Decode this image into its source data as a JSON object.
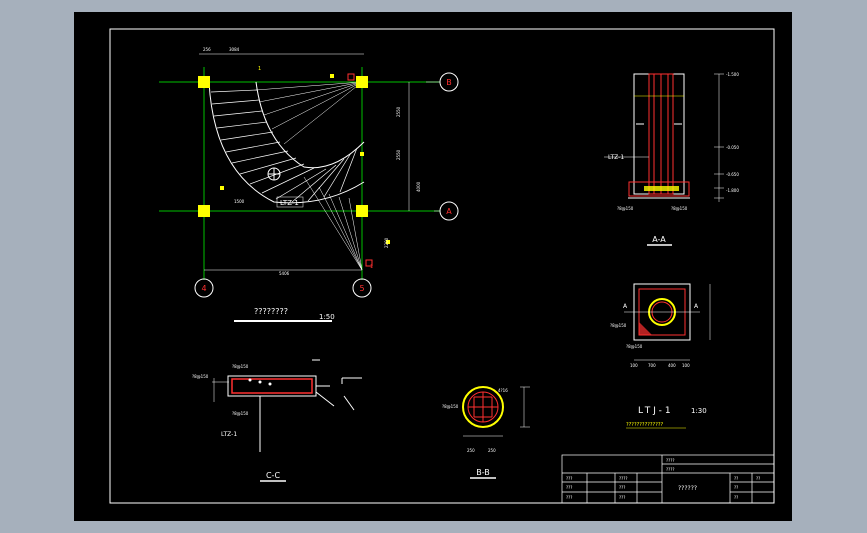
{
  "plan": {
    "axes": {
      "top_right": "B",
      "bottom_right": "A",
      "bottom_left": "4",
      "bottom_mid": "5"
    },
    "title": "????????",
    "scale": "1:50",
    "dims": [
      "256",
      "3084",
      "2550",
      "2550",
      "4000",
      "5406",
      "1500",
      "2200"
    ],
    "marks": [
      "1",
      "1"
    ],
    "labels": [
      "LTZ-1",
      "LTZ-1"
    ]
  },
  "section_aa": {
    "title": "A-A",
    "label": "LTZ-1",
    "rebar": [
      "?8@150",
      "?8@150"
    ],
    "elev": [
      "-1.500",
      "-0.050",
      "-0.650",
      "-1.800"
    ],
    "dims": [
      "1800",
      "1050",
      "750",
      "300"
    ]
  },
  "ltj": {
    "title": "LTJ-1",
    "scale": "1:30",
    "a_left": "A",
    "a_right": "A",
    "rebar": [
      "?8@150",
      "?8@150"
    ],
    "dims": [
      "100",
      "700",
      "400",
      "100"
    ],
    "note": "??????????????"
  },
  "section_cc": {
    "title": "C-C",
    "label": "LTZ-1",
    "rebar": [
      "?8@150",
      "?8@150",
      "?8@150"
    ]
  },
  "section_bb": {
    "title": "B-B",
    "rebar": [
      "?8@150",
      "4?16"
    ],
    "dims": [
      "250",
      "250"
    ]
  },
  "title_block": {
    "cells": [
      "????",
      "????",
      "????",
      "???",
      "???",
      "???",
      "???",
      "???",
      "??",
      "??",
      "??",
      "??"
    ],
    "drawing_name": "??????"
  }
}
